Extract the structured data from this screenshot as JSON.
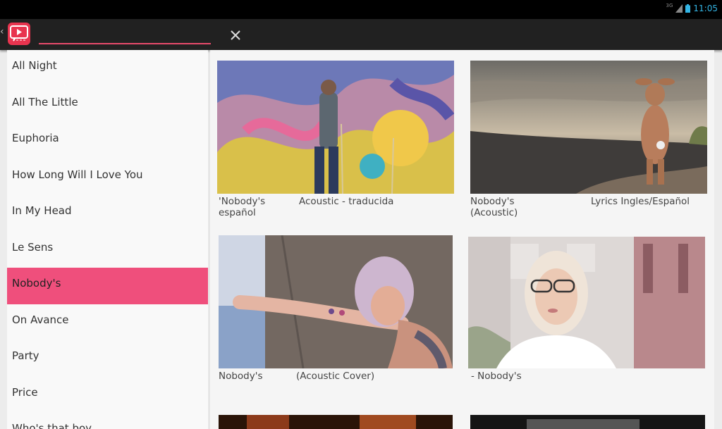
{
  "status_bar": {
    "signal": "3G",
    "time": "11:05"
  },
  "toolbar": {
    "search_value": ""
  },
  "sidebar": {
    "items": [
      {
        "label": "All Night"
      },
      {
        "label": "All The Little"
      },
      {
        "label": "Euphoria"
      },
      {
        "label": "How Long Will I Love You"
      },
      {
        "label": "In My Head"
      },
      {
        "label": "Le Sens"
      },
      {
        "label": "Nobody's"
      },
      {
        "label": "On Avance"
      },
      {
        "label": "Party"
      },
      {
        "label": "Price"
      },
      {
        "label": "Who's that boy"
      }
    ],
    "selected_index": 6
  },
  "videos": [
    {
      "caption_a": "'Nobody's",
      "caption_a2": "español",
      "caption_b": "Acoustic - traducida"
    },
    {
      "caption_a": "Nobody's",
      "caption_a2": "(Acoustic)",
      "caption_b": "Lyrics Ingles/Español"
    },
    {
      "caption_a": "Nobody's",
      "caption_a2": "",
      "caption_b": "(Acoustic Cover)"
    },
    {
      "caption_a": "- Nobody's",
      "caption_a2": "",
      "caption_b": ""
    }
  ],
  "colors": {
    "accent": "#ef4f7c",
    "toolbar": "#212121",
    "time": "#33b5e5"
  }
}
